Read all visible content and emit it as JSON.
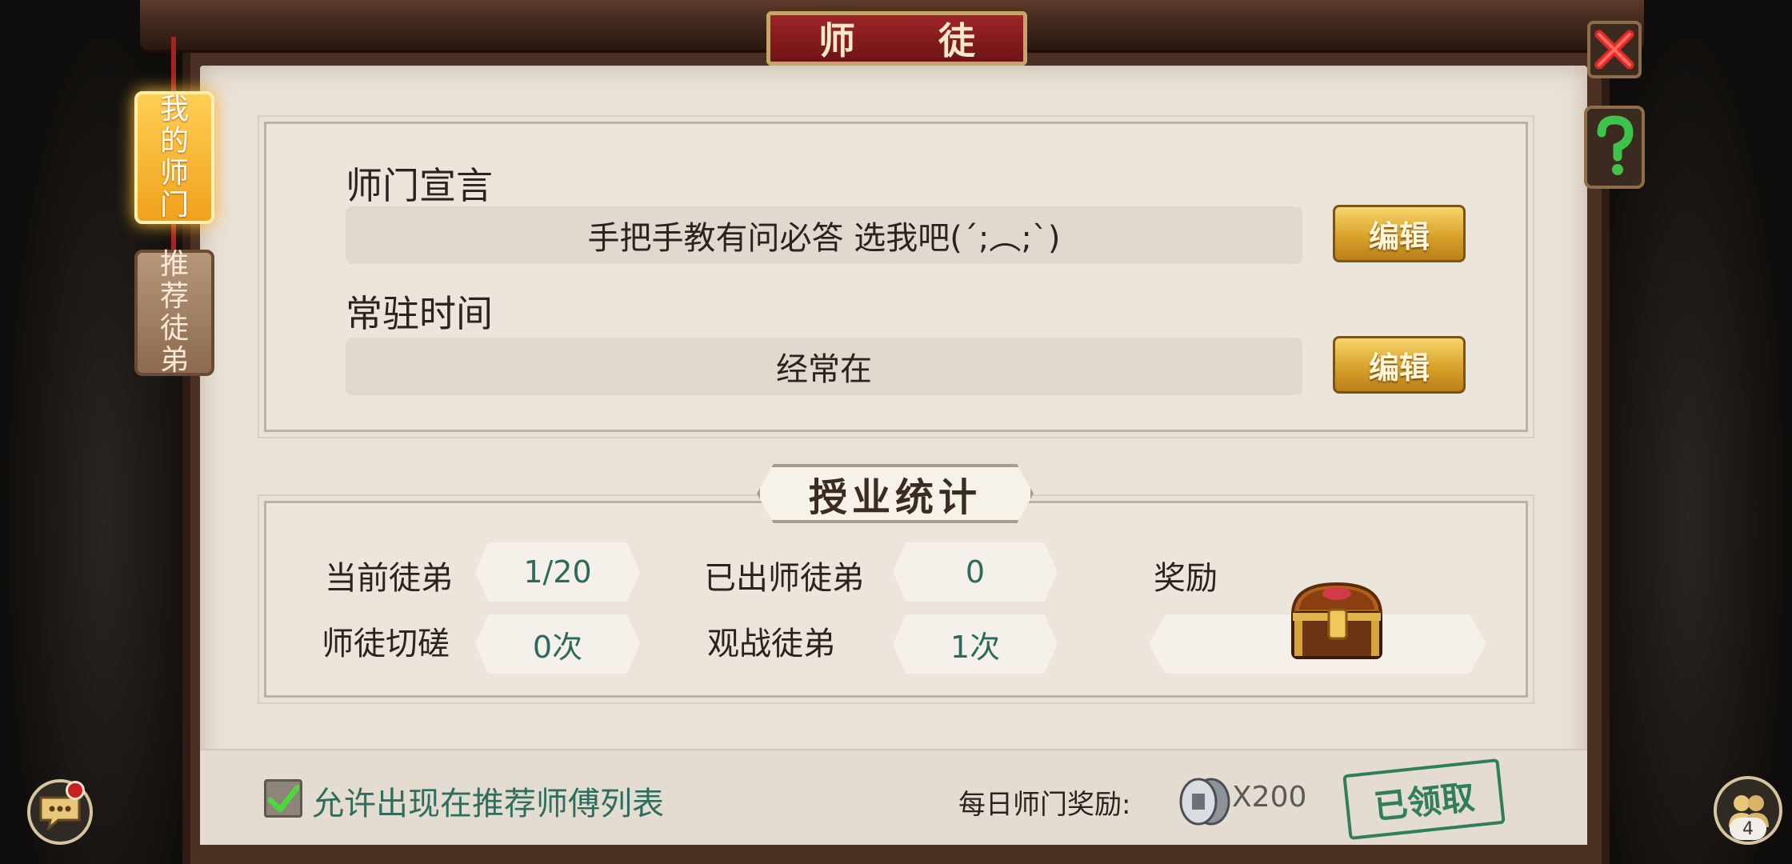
{
  "window": {
    "title": "师 徒"
  },
  "tabs": [
    {
      "label": "我的师门",
      "chars": [
        "我",
        "的",
        "师",
        "门"
      ],
      "active": true
    },
    {
      "label": "推荐徒弟",
      "chars": [
        "推",
        "荐",
        "徒",
        "弟"
      ],
      "active": false
    }
  ],
  "declaration": {
    "heading": "师门宣言",
    "value": "手把手教有问必答 选我吧(´;︵;`)",
    "edit_label": "编辑"
  },
  "resident_time": {
    "heading": "常驻时间",
    "value": "经常在",
    "edit_label": "编辑"
  },
  "stats": {
    "section_title": "授业统计",
    "current_disciples_label": "当前徒弟",
    "current_disciples_value": "1/20",
    "graduated_label": "已出师徒弟",
    "graduated_value": "0",
    "sparring_label": "师徒切磋",
    "sparring_value": "0次",
    "spectate_label": "观战徒弟",
    "spectate_value": "1次",
    "reward_label": "奖励"
  },
  "footer": {
    "allow_label": "允许出现在推荐师傅列表",
    "allow_checked": true,
    "daily_reward_label": "每日师门奖励:",
    "coin_quantity": "X200",
    "claimed_stamp": "已领取"
  },
  "corner": {
    "friends_count": "4"
  },
  "colors": {
    "accent_teal": "#2c6a5c",
    "title_red": "#9d2427",
    "gold_button": "#d9a22a"
  },
  "icons": [
    "close-icon",
    "help-icon",
    "chat-icon",
    "friends-icon",
    "treasure-chest-icon",
    "coin-icon",
    "checkmark-icon"
  ]
}
